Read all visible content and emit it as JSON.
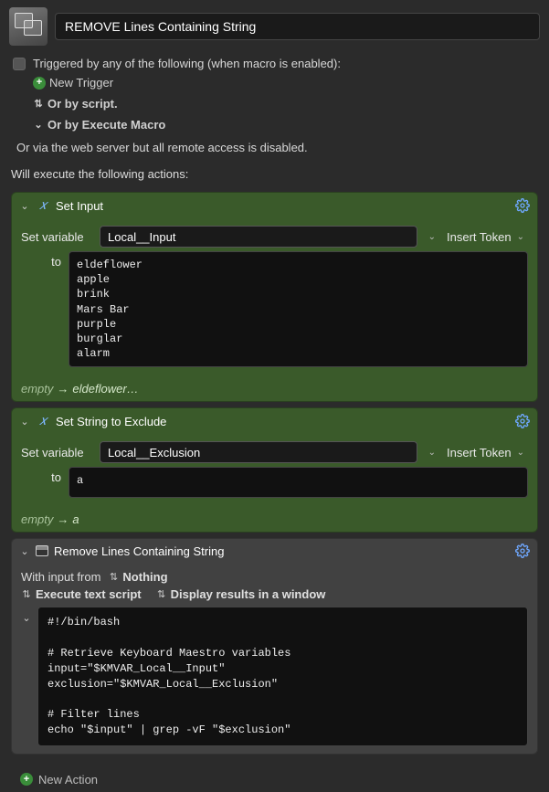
{
  "header": {
    "macro_name": "REMOVE Lines Containing String"
  },
  "trigger": {
    "label": "Triggered by any of the following (when macro is enabled):",
    "new_trigger": "New Trigger",
    "or_script": "Or by script.",
    "or_execute_macro": "Or by Execute Macro",
    "or_web": "Or via the web server but all remote access is disabled."
  },
  "exec_label": "Will execute the following actions:",
  "actions": [
    {
      "title": "Set Input",
      "set_variable_label": "Set variable",
      "variable_name": "Local__Input",
      "insert_token_label": "Insert Token",
      "to_label": "to",
      "value": "eldeflower\napple\nbrink\nMars Bar\npurple\nburglar\nalarm",
      "status_from": "empty",
      "status_to": "eldeflower…"
    },
    {
      "title": "Set String to Exclude",
      "set_variable_label": "Set variable",
      "variable_name": "Local__Exclusion",
      "insert_token_label": "Insert Token",
      "to_label": "to",
      "value": "a",
      "status_from": "empty",
      "status_to": "a"
    },
    {
      "title": "Remove Lines Containing String",
      "with_input_label": "With input from",
      "with_input_value": "Nothing",
      "execute_script_label": "Execute text script",
      "display_results_label": "Display results in a window",
      "script": "#!/bin/bash\n\n# Retrieve Keyboard Maestro variables\ninput=\"$KMVAR_Local__Input\"\nexclusion=\"$KMVAR_Local__Exclusion\"\n\n# Filter lines\necho \"$input\" | grep -vF \"$exclusion\""
    }
  ],
  "new_action_label": "New Action"
}
